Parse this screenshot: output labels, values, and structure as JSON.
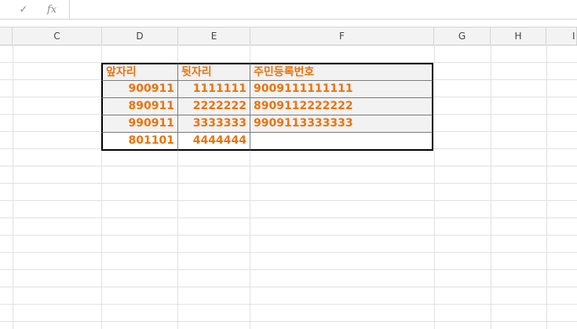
{
  "formula_bar": {
    "confirm_icon": "checkmark-icon",
    "function_icon": "fx-icon",
    "confirm_symbol": "✓",
    "function_symbol": "fx",
    "content": ""
  },
  "columns": [
    "C",
    "D",
    "E",
    "F",
    "G",
    "H",
    "I"
  ],
  "table": {
    "headers": [
      "앞자리",
      "뒷자리",
      "주민등록번호"
    ],
    "rows": [
      [
        "900911",
        "1111111",
        "9009111111111"
      ],
      [
        "890911",
        "2222222",
        "8909112222222"
      ],
      [
        "990911",
        "3333333",
        "9909113333333"
      ],
      [
        "801101",
        "4444444",
        ""
      ]
    ]
  },
  "colors": {
    "text_accent": "#e8740c",
    "header_fill": "#f2f2f2",
    "row_fill_alt": "#f2f2f2",
    "border": "#000000"
  }
}
